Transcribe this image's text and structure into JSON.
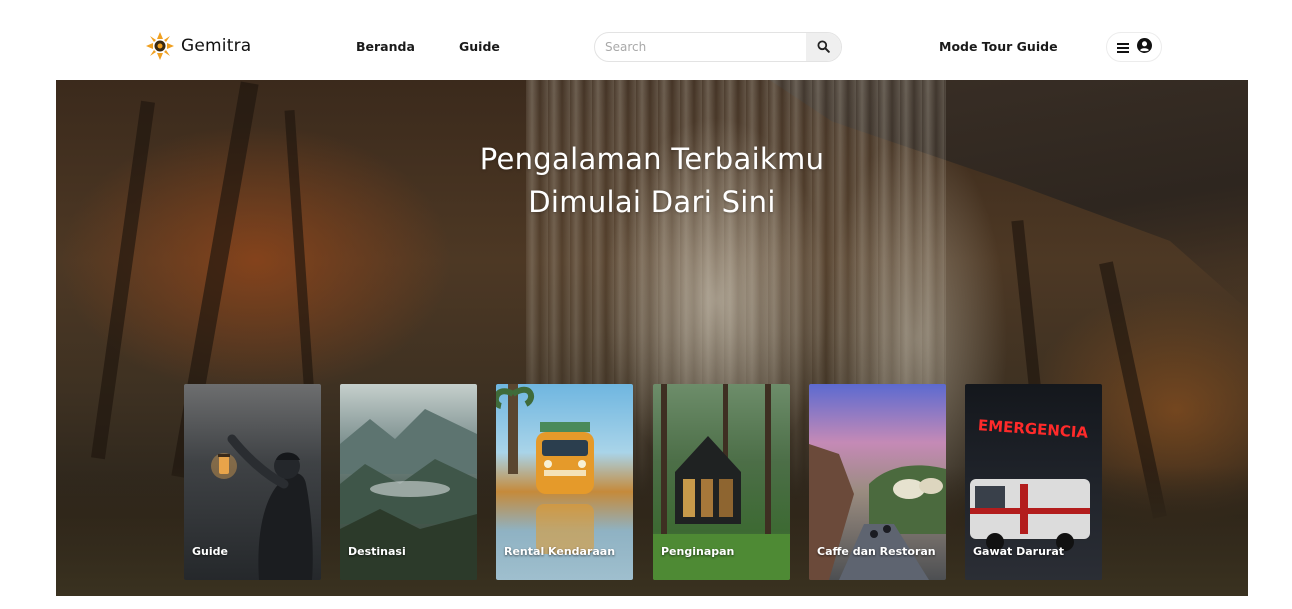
{
  "header": {
    "brand": "Gemitra",
    "nav": {
      "beranda": "Beranda",
      "guide": "Guide"
    },
    "search": {
      "placeholder": "Search"
    },
    "mode_link": "Mode Tour Guide"
  },
  "hero": {
    "title_line1": "Pengalaman Terbaikmu",
    "title_line2": "Dimulai Dari Sini"
  },
  "categories": [
    {
      "label": "Guide"
    },
    {
      "label": "Destinasi"
    },
    {
      "label": "Rental Kendaraan"
    },
    {
      "label": "Penginapan"
    },
    {
      "label": "Caffe dan Restoran"
    },
    {
      "label": "Gawat Darurat",
      "sign_text": "EMERGENCIA"
    }
  ],
  "colors": {
    "logo_accent": "#f0a020",
    "header_bg": "#ffffff",
    "hero_text": "#ffffff"
  },
  "icons": {
    "logo": "sun-logo-icon",
    "search": "search-icon",
    "menu": "hamburger-menu-icon",
    "user": "user-circle-icon"
  }
}
